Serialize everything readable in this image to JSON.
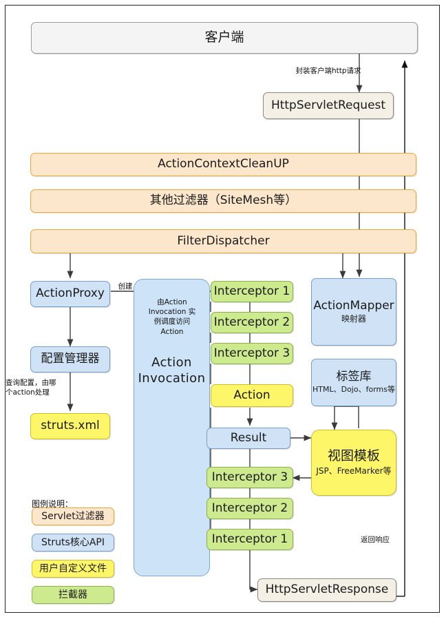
{
  "diagram": {
    "title_client": "客户端",
    "http_request": "HttpServletRequest",
    "http_response": "HttpServletResponse",
    "filters": [
      "ActionContextCleanUP",
      "其他过滤器（SiteMesh等）",
      "FilterDispatcher"
    ],
    "action_proxy": "ActionProxy",
    "config_manager": "配置管理器",
    "struts_xml": "struts.xml",
    "action_invocation": "Action\nInvocation",
    "action_invocation_line1": "Action",
    "action_invocation_line2": "Invocation",
    "interceptors_down": [
      "Interceptor 1",
      "Interceptor 2",
      "Interceptor 3"
    ],
    "action": "Action",
    "result": "Result",
    "interceptors_up": [
      "Interceptor 3",
      "Interceptor 2",
      "Interceptor 1"
    ],
    "action_mapper": "ActionMapper",
    "action_mapper_sub": "映射器",
    "tag_library": "标签库",
    "tag_library_sub": "HTML、Dojo、forms等",
    "view_template": "视图模板",
    "view_template_sub": "JSP、FreeMarker等",
    "labels": {
      "encapsulate_request": "封装客户端http请求",
      "create": "创建",
      "dispatch_note": "由Action\nInvocation 实\n例调度访问\nAction",
      "query_config": "查询配置，由哪\n个action处理",
      "return_response": "返回响应"
    },
    "legend": {
      "title": "图例说明：",
      "items": [
        {
          "label": "Servlet过滤器",
          "color": "#fde7cc"
        },
        {
          "label": "Struts核心API",
          "color": "#cfe2f6"
        },
        {
          "label": "用户自定义文件",
          "color": "#fdf668"
        },
        {
          "label": "拦截器",
          "color": "#cdea8e"
        }
      ]
    },
    "colors": {
      "filter": "#fde7cc",
      "api": "#cfe2f6",
      "userfile": "#fdf668",
      "interceptor": "#cdea8e",
      "servlet": "#f5f0e6",
      "client": "#f4f4f4",
      "panel": "#cde3f7"
    }
  }
}
